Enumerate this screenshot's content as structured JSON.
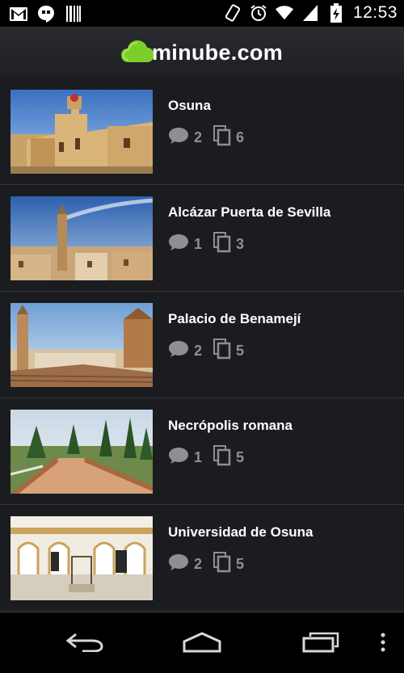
{
  "status_bar": {
    "time": "12:53",
    "icons": [
      "gmail-icon",
      "hangouts-icon",
      "barcode-icon",
      "vibrate-icon",
      "alarm-icon",
      "wifi-icon",
      "signal-icon",
      "battery-charging-icon"
    ]
  },
  "header": {
    "logo_text": "minube.com",
    "brand_color": "#7ccf2a"
  },
  "places": [
    {
      "title": "Osuna",
      "comments": "2",
      "photos": "6"
    },
    {
      "title": "Alcázar Puerta de Sevilla",
      "comments": "1",
      "photos": "3"
    },
    {
      "title": "Palacio de Benamejí",
      "comments": "2",
      "photos": "5"
    },
    {
      "title": "Necrópolis romana",
      "comments": "1",
      "photos": "5"
    },
    {
      "title": "Universidad de Osuna",
      "comments": "2",
      "photos": "5"
    }
  ],
  "nav_bar": {
    "icons": [
      "back-icon",
      "home-icon",
      "recent-apps-icon",
      "overflow-menu-icon"
    ]
  }
}
